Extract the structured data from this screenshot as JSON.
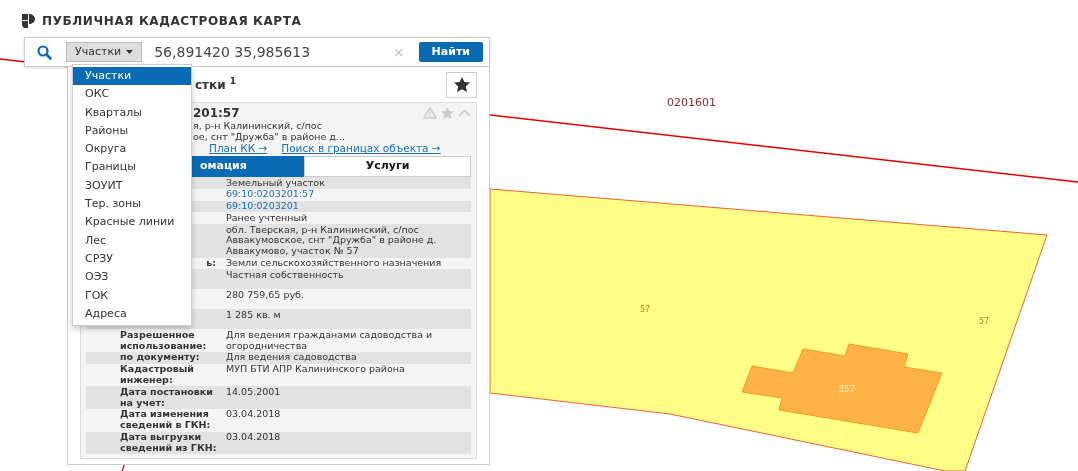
{
  "header": {
    "title": "ПУБЛИЧНАЯ КАДАСТРОВАЯ КАРТА"
  },
  "search": {
    "category": "Участки",
    "value": "56,891420 35,985613",
    "clear": "×",
    "button": "Найти"
  },
  "dropdown": {
    "items": [
      {
        "label": "Участки",
        "selected": true
      },
      {
        "label": "ОКС",
        "selected": false
      },
      {
        "label": "Кварталы",
        "selected": false
      },
      {
        "label": "Районы",
        "selected": false
      },
      {
        "label": "Округа",
        "selected": false
      },
      {
        "label": "Границы",
        "selected": false
      },
      {
        "label": "ЗОУИТ",
        "selected": false
      },
      {
        "label": "Тер. зоны",
        "selected": false
      },
      {
        "label": "Красные линии",
        "selected": false
      },
      {
        "label": "Лес",
        "selected": false
      },
      {
        "label": "СРЗУ",
        "selected": false
      },
      {
        "label": "ОЭЗ",
        "selected": false
      },
      {
        "label": "ГОК",
        "selected": false
      },
      {
        "label": "Адреса",
        "selected": false
      }
    ]
  },
  "panel": {
    "heading": "стки $^{1}$",
    "card": {
      "title": "201:57",
      "address_lines": [
        "я, р-н Калининский, с/пос",
        "ое, снт \"Дружба\" в районе д..."
      ],
      "links": [
        "План КК →",
        "Поиск в границах объекта →"
      ],
      "tabs": [
        {
          "label": "омация",
          "selected": true
        },
        {
          "label": "Услуги",
          "selected": false
        }
      ],
      "rows": [
        {
          "value": "Земельный участок",
          "kind": "text"
        },
        {
          "value": "69:10:0203201:57",
          "kind": "link"
        },
        {
          "value": "69:10:0203201",
          "kind": "link"
        },
        {
          "value": "Ранее учтенный",
          "kind": "text"
        },
        {
          "value": "обл. Тверская, р-н Калининский, с/пос Аввакумовское, снт \"Дружба\" в районе д. Аввакумово, участок № 57",
          "kind": "text"
        },
        {
          "label": "ь:",
          "label_partial": true,
          "value": "Земли сельскохозяйственного назначения",
          "kind": "text"
        },
        {
          "value": "Частная собственность",
          "kind": "tall"
        },
        {
          "value": "280 759,65 руб.",
          "kind": "tall"
        },
        {
          "value": "1 285 кв. м",
          "kind": "tall"
        },
        {
          "label": "Разрешенное использование:",
          "value": "Для ведения гражданами садоводства и огородничества",
          "kind": "text"
        },
        {
          "label": "по документу:",
          "value": "Для ведения садоводства",
          "kind": "text"
        },
        {
          "label": "Кадастровый инженер:",
          "value": "МУП БТИ АПР Калининского района",
          "kind": "text"
        },
        {
          "label": "Дата постановки на учет:",
          "value": "14.05.2001",
          "kind": "text"
        },
        {
          "label": "Дата изменения сведений в ГКН:",
          "value": "03.04.2018",
          "kind": "text"
        },
        {
          "label": "Дата выгрузки сведений из ГКН:",
          "value": "03.04.2018",
          "kind": "text"
        }
      ]
    }
  },
  "map": {
    "labels": [
      {
        "text": "0201601",
        "kind": "quarter"
      },
      {
        "text": "57",
        "kind": "plot"
      },
      {
        "text": "57",
        "kind": "plot"
      },
      {
        "text": "357",
        "kind": "building"
      }
    ]
  }
}
